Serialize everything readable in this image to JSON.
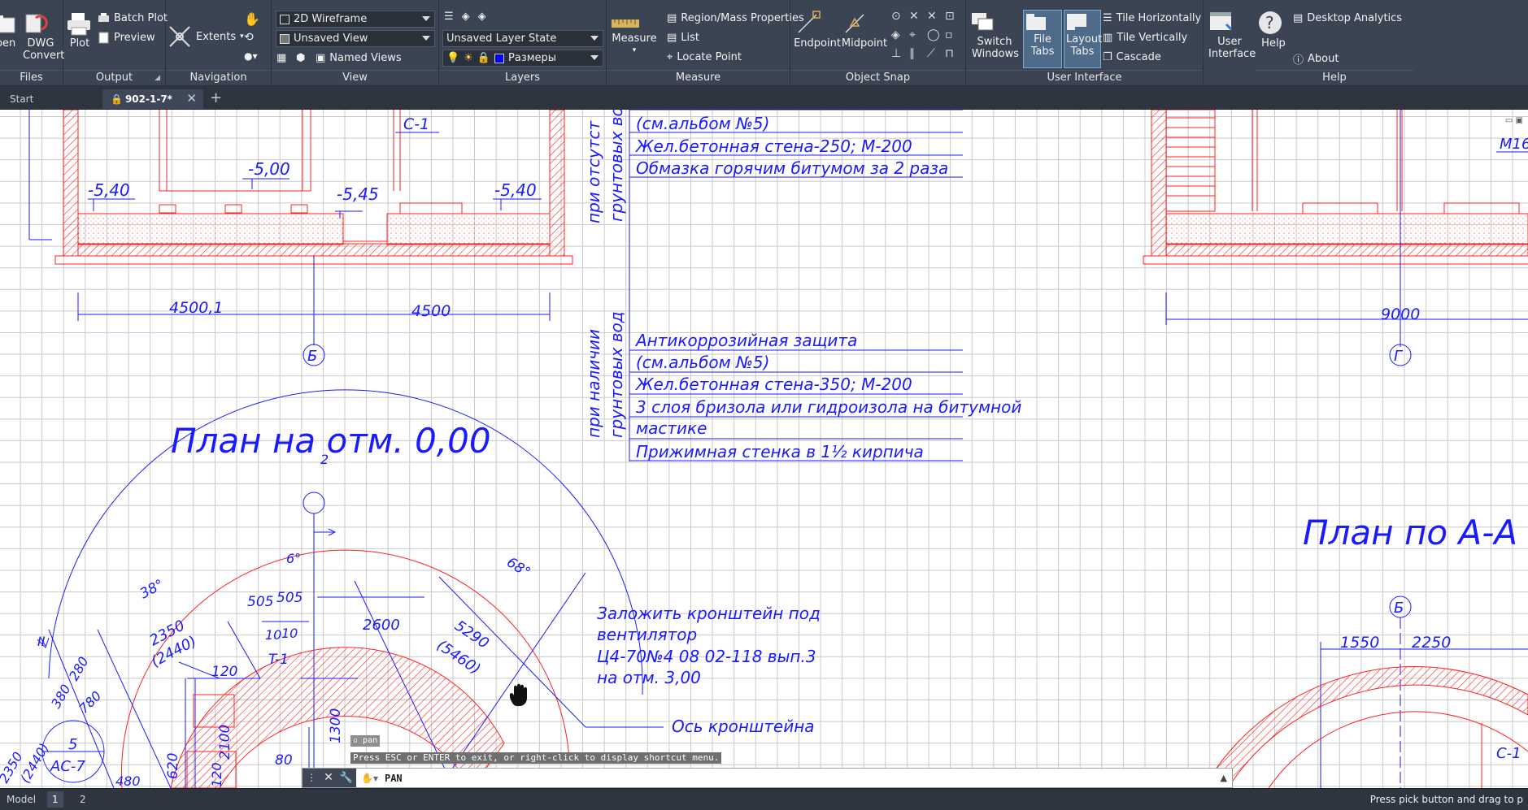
{
  "ribbon": {
    "files": {
      "title": "Files",
      "open_label": "pen",
      "dwg_convert_label": "DWG Convert"
    },
    "output": {
      "title": "Output",
      "plot_label": "Plot",
      "batch_plot_label": "Batch Plot",
      "preview_label": "Preview"
    },
    "navigation": {
      "title": "Navigation",
      "extents_label": "Extents"
    },
    "view": {
      "title": "View",
      "visual_style": "2D Wireframe",
      "saved_view": "Unsaved View",
      "named_views_label": "Named Views"
    },
    "layers": {
      "title": "Layers",
      "layer_state": "Unsaved Layer State",
      "current_layer": "Размеры",
      "current_layer_color": "#0000ff"
    },
    "measure": {
      "title": "Measure",
      "measure_label": "Measure",
      "region_mass_label": "Region/Mass Properties",
      "list_label": "List",
      "locate_point_label": "Locate Point"
    },
    "object_snap": {
      "title": "Object Snap",
      "endpoint_label": "Endpoint",
      "midpoint_label": "Midpoint"
    },
    "user_interface": {
      "title": "User Interface",
      "switch_windows_label": "Switch Windows",
      "file_tabs_label": "File Tabs",
      "layout_tabs_label": "Layout Tabs",
      "tile_horizontally_label": "Tile Horizontally",
      "tile_vertically_label": "Tile Vertically",
      "cascade_label": "Cascade",
      "user_interface_label": "User Interface"
    },
    "help": {
      "title": "Help",
      "help_label": "Help",
      "desktop_analytics_label": "Desktop Analytics",
      "about_label": "About"
    }
  },
  "file_tabs": {
    "start_label": "Start",
    "active_label": "902-1-7*",
    "new_tab_label": "+"
  },
  "drawing": {
    "elevations": [
      "-5,40",
      "-5,00",
      "-5,45",
      "-5,40"
    ],
    "section_mark": "С-1",
    "dims_top": [
      "4500,1",
      "4500",
      "9000"
    ],
    "axis_b": "Б",
    "axis_g": "Г",
    "plan_title_1": "План на отм. 0,00",
    "plan_title_2": "План по А-А",
    "vertical_label_1a": "при отсутст",
    "vertical_label_1b": "грунтовых во",
    "vertical_label_2a": "при наличии",
    "vertical_label_2b": "грунтовых вод",
    "spec_rows_top": [
      "(см.альбом №5)",
      "Жел.бетонная стена-250; М-200",
      "Обмазка горячим битумом за 2 раза"
    ],
    "spec_rows_bottom": [
      "Антикоррозийная защита",
      "(см.альбом №5)",
      "Жел.бетонная стена-350; М-200",
      "3 слоя бризола или гидроизола на битумной",
      "мастике",
      "Прижимная стенка в 1½ кирпича"
    ],
    "note_lines": [
      "Заложить кронштейн под",
      "вентилятор",
      "Ц4-70№4 08 02-118 вып.3",
      "на отм. 3,00"
    ],
    "axis_note": "Ось кронштейна",
    "plan_dims": [
      "2",
      "6°",
      "38°",
      "68°",
      "2350",
      "(2440)",
      "505",
      "505",
      "10",
      "10",
      "T-1",
      "2600",
      "5290",
      "(5460)",
      "120",
      "380",
      "280",
      "780",
      "2100",
      "1300",
      "620",
      "80",
      "1550",
      "2250",
      "II",
      "5",
      "АС-7",
      "С-1",
      "М16"
    ],
    "partial_left": [
      "2350",
      "(2440)",
      "480",
      "120"
    ]
  },
  "pan_tooltip": "pan",
  "command": {
    "hint": "Press ESC or ENTER to exit, or right-click to display shortcut menu.",
    "current": "PAN"
  },
  "status": {
    "model_label": "Model",
    "layout1_label": "1",
    "layout2_label": "2",
    "message": "Press pick button and drag to p"
  }
}
